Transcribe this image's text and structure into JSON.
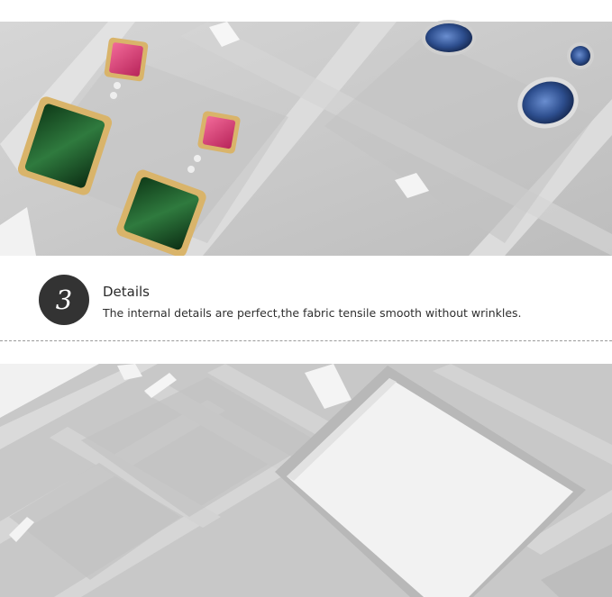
{
  "section": {
    "number": "3",
    "title": "Details",
    "description": "The internal details are perfect,the fabric tensile smooth without wrinkles."
  },
  "colors": {
    "velvet": "#c9c9c9",
    "velvet_dark": "#b3b3b3",
    "badge": "#333333",
    "emerald": "#1f5a2c",
    "ruby": "#e0407a",
    "sapphire": "#2e4f8f",
    "gold": "#c9a24a"
  },
  "icons": [
    "earring-emerald-left",
    "earring-emerald-right",
    "earring-sapphire",
    "ribbon-tab",
    "card-insert"
  ]
}
